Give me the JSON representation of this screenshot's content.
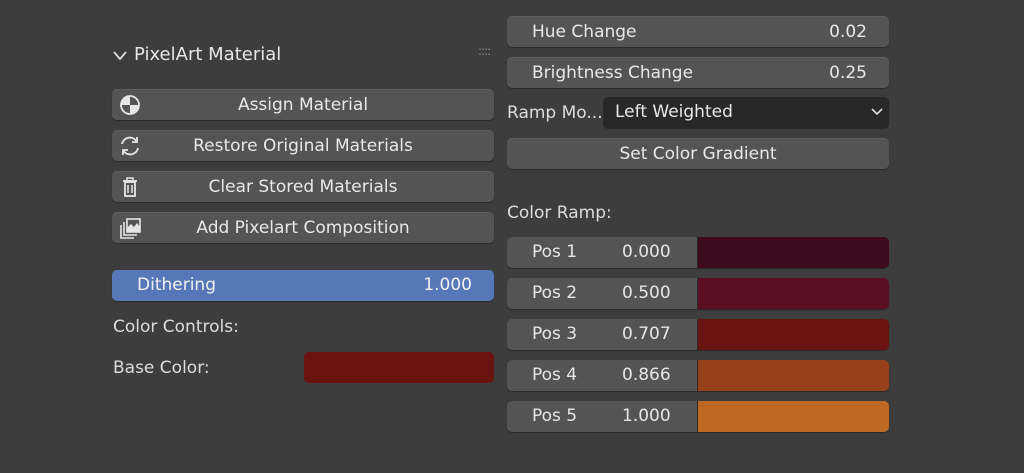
{
  "panel": {
    "title": "PixelArt Material",
    "drag_handle": "::::"
  },
  "left": {
    "assign_label": "Assign Material",
    "restore_label": "Restore Original Materials",
    "clear_label": "Clear Stored Materials",
    "add_comp_label": "Add Pixelart Composition",
    "dithering": {
      "label": "Dithering",
      "value": "1.000",
      "fill_fraction": 1.0
    },
    "color_controls_label": "Color Controls:",
    "base_color_label": "Base Color:",
    "base_color": "#6b1310"
  },
  "right": {
    "hue": {
      "label": "Hue Change",
      "value": "0.02"
    },
    "brightness": {
      "label": "Brightness Change",
      "value": "0.25"
    },
    "ramp_mode": {
      "label": "Ramp Mo...",
      "selected": "Left Weighted"
    },
    "set_gradient_label": "Set Color Gradient",
    "color_ramp_label": "Color Ramp:",
    "ramp": [
      {
        "name": "Pos 1",
        "value": "0.000",
        "color": "#3e0a1e"
      },
      {
        "name": "Pos 2",
        "value": "0.500",
        "color": "#5a0e22"
      },
      {
        "name": "Pos 3",
        "value": "0.707",
        "color": "#6b1310"
      },
      {
        "name": "Pos 4",
        "value": "0.866",
        "color": "#964119"
      },
      {
        "name": "Pos 5",
        "value": "1.000",
        "color": "#bd6923"
      }
    ]
  },
  "colors": {
    "background": "#3d3d3d",
    "button": "#545454",
    "accent": "#5778b8",
    "dropdown": "#282828"
  }
}
